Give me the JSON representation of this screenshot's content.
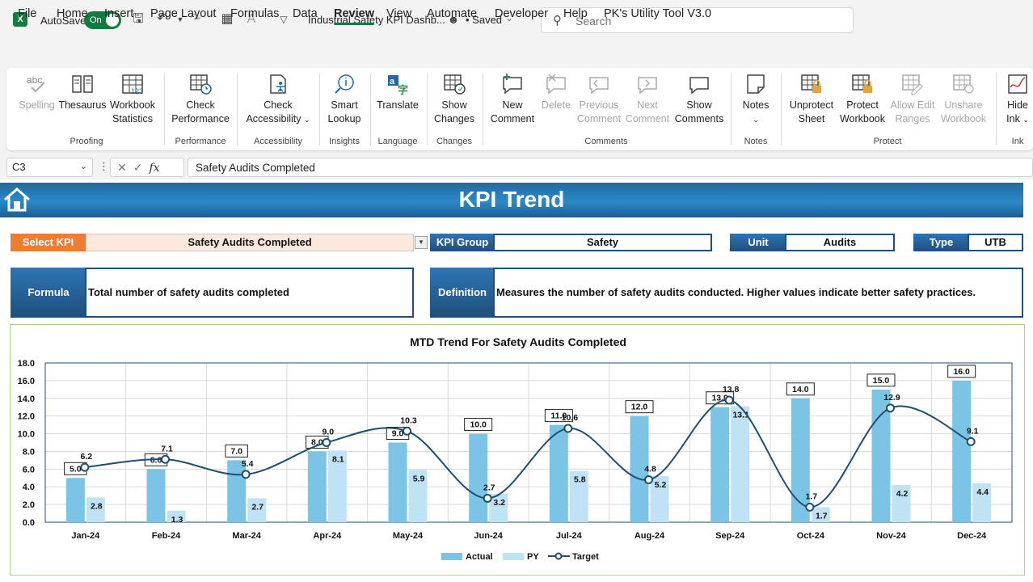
{
  "app": {
    "logo": "X",
    "autosave_label": "AutoSave",
    "autosave_state": "On",
    "doc_title": "Industrial Safety KPI Dashb...",
    "saved": "• Saved",
    "search_placeholder": "Search"
  },
  "menu": [
    "File",
    "Home",
    "Insert",
    "Page Layout",
    "Formulas",
    "Data",
    "Review",
    "View",
    "Automate",
    "Developer",
    "Help",
    "PK's Utility Tool V3.0"
  ],
  "active_menu": "Review",
  "ribbon": {
    "proofing": {
      "spelling": "Spelling",
      "thesaurus": "Thesaurus",
      "workbook": "Workbook",
      "statistics": "Statistics",
      "label": "Proofing"
    },
    "performance": {
      "check": "Check",
      "performance": "Performance",
      "label": "Performance"
    },
    "accessibility": {
      "check": "Check",
      "accessibility": "Accessibility",
      "label": "Accessibility"
    },
    "insights": {
      "smart": "Smart",
      "lookup": "Lookup",
      "label": "Insights"
    },
    "language": {
      "translate": "Translate",
      "label": "Language"
    },
    "changes": {
      "show": "Show",
      "changes": "Changes",
      "label": "Changes"
    },
    "comments": {
      "new1": "New",
      "new2": "Comment",
      "delete": "Delete",
      "prev1": "Previous",
      "prev2": "Comment",
      "next1": "Next",
      "next2": "Comment",
      "show1": "Show",
      "show2": "Comments",
      "label": "Comments"
    },
    "notes": {
      "notes": "Notes",
      "label": "Notes"
    },
    "protect": {
      "unprotect1": "Unprotect",
      "unprotect2": "Sheet",
      "protect1": "Protect",
      "protect2": "Workbook",
      "allow1": "Allow Edit",
      "allow2": "Ranges",
      "unshare1": "Unshare",
      "unshare2": "Workbook",
      "label": "Protect"
    },
    "ink": {
      "hide": "Hide",
      "ink": "Ink",
      "label": "Ink"
    }
  },
  "formula_bar": {
    "cell": "C3",
    "fx": "fx",
    "content": "Safety Audits Completed"
  },
  "dashboard": {
    "title": "KPI Trend",
    "select_kpi_label": "Select KPI",
    "select_kpi_value": "Safety Audits Completed",
    "kpi_group_label": "KPI Group",
    "kpi_group_value": "Safety",
    "unit_label": "Unit",
    "unit_value": "Audits",
    "type_label": "Type",
    "type_value": "UTB",
    "formula_label": "Formula",
    "formula_value": "Total number of safety audits completed",
    "definition_label": "Definition",
    "definition_value": "Measures the number of safety audits conducted. Higher values indicate better safety practices."
  },
  "chart_data": {
    "type": "bar",
    "title": "MTD Trend For Safety Audits Completed",
    "categories": [
      "Jan-24",
      "Feb-24",
      "Mar-24",
      "Apr-24",
      "May-24",
      "Jun-24",
      "Jul-24",
      "Aug-24",
      "Sep-24",
      "Oct-24",
      "Nov-24",
      "Dec-24"
    ],
    "series": [
      {
        "name": "Actual",
        "kind": "bar",
        "color": "#7cc4e6",
        "values": [
          5.0,
          6.0,
          7.0,
          8.0,
          9.0,
          10.0,
          11.0,
          12.0,
          13.0,
          14.0,
          15.0,
          16.0
        ]
      },
      {
        "name": "PY",
        "kind": "bar",
        "color": "#bfe3f5",
        "values": [
          2.8,
          1.3,
          2.7,
          8.1,
          5.9,
          3.2,
          5.8,
          5.2,
          13.1,
          1.7,
          4.2,
          4.4
        ]
      },
      {
        "name": "Target",
        "kind": "line",
        "color": "#1f4e6e",
        "values": [
          6.2,
          7.1,
          5.4,
          9.0,
          10.3,
          2.7,
          10.6,
          4.8,
          13.8,
          1.7,
          12.9,
          9.1
        ]
      }
    ],
    "yticks": [
      "0.0",
      "2.0",
      "4.0",
      "6.0",
      "8.0",
      "10.0",
      "12.0",
      "14.0",
      "16.0",
      "18.0"
    ],
    "ylim": [
      0,
      18
    ],
    "grid": true,
    "legend": "bottom-center"
  }
}
